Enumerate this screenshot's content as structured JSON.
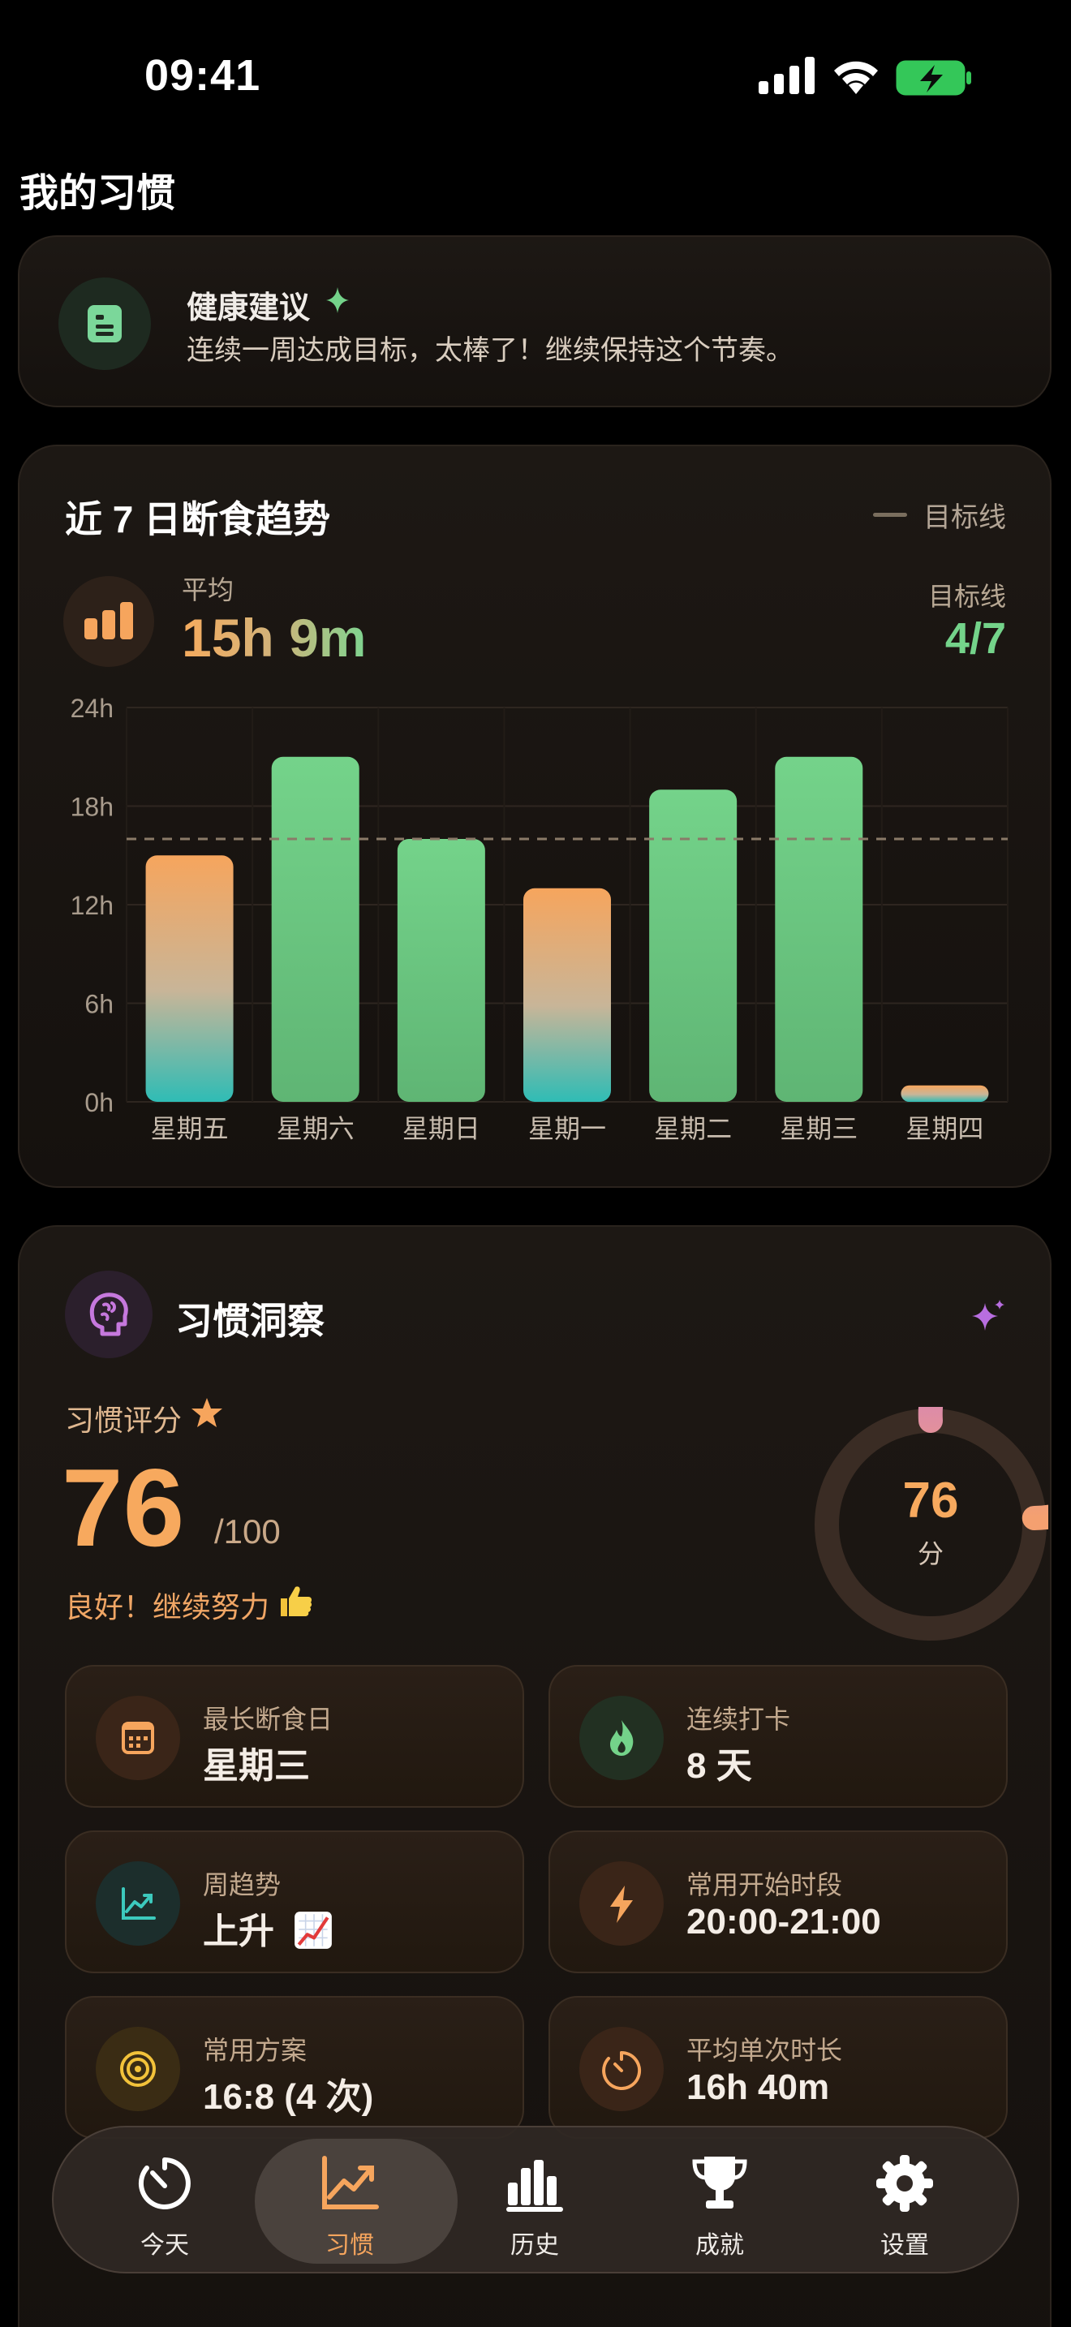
{
  "status_bar": {
    "time": "09:41"
  },
  "page": {
    "title": "我的习惯"
  },
  "advice": {
    "title": "健康建议",
    "text": "连续一周达成目标，太棒了！继续保持这个节奏。",
    "icon": "notes-icon"
  },
  "trend": {
    "title": "近 7 日断食趋势",
    "legend_label": "目标线",
    "avg_label": "平均",
    "avg_value": "15h 9m",
    "goal_label": "目标线",
    "goal_value": "4/7",
    "colors": {
      "met": "#74d38a",
      "unmet_top": "#f6a55d",
      "unmet_bottom": "#2fbcb5",
      "goal_line": "#8a7a68"
    }
  },
  "chart_data": {
    "type": "bar",
    "categories": [
      "星期五",
      "星期六",
      "星期日",
      "星期一",
      "星期二",
      "星期三",
      "星期四"
    ],
    "values": [
      15,
      21,
      16,
      13,
      19,
      21,
      1
    ],
    "goal_met": [
      false,
      true,
      true,
      false,
      true,
      true,
      false
    ],
    "goal": 16,
    "ylim": [
      0,
      24
    ],
    "yticks": [
      0,
      6,
      12,
      18,
      24
    ],
    "ytick_labels": [
      "0h",
      "6h",
      "12h",
      "18h",
      "24h"
    ],
    "xlabel": "",
    "ylabel": "",
    "grid": true
  },
  "insight": {
    "title": "习惯洞察",
    "score_label": "习惯评分",
    "score": "76",
    "score_max": "/100",
    "score_value": 76,
    "ring_value": "76",
    "ring_unit": "分",
    "message": "良好！继续努力",
    "stats": [
      {
        "label": "最长断食日",
        "value": "星期三",
        "icon": "calendar-icon"
      },
      {
        "label": "连续打卡",
        "value": "8 天",
        "icon": "flame-icon"
      },
      {
        "label": "周趋势",
        "value": "上升",
        "icon": "trend-up-icon"
      },
      {
        "label": "常用开始时段",
        "value": "20:00-21:00",
        "icon": "bolt-icon"
      },
      {
        "label": "常用方案",
        "value": "16:8 (4 次)",
        "icon": "target-icon"
      },
      {
        "label": "平均单次时长",
        "value": "16h 40m",
        "icon": "timer-icon"
      }
    ]
  },
  "tabbar": {
    "items": [
      {
        "label": "今天",
        "icon": "timer-icon"
      },
      {
        "label": "习惯",
        "icon": "chart-line-icon",
        "active": true
      },
      {
        "label": "历史",
        "icon": "bar-chart-icon"
      },
      {
        "label": "成就",
        "icon": "trophy-icon"
      },
      {
        "label": "设置",
        "icon": "gear-icon"
      }
    ]
  }
}
